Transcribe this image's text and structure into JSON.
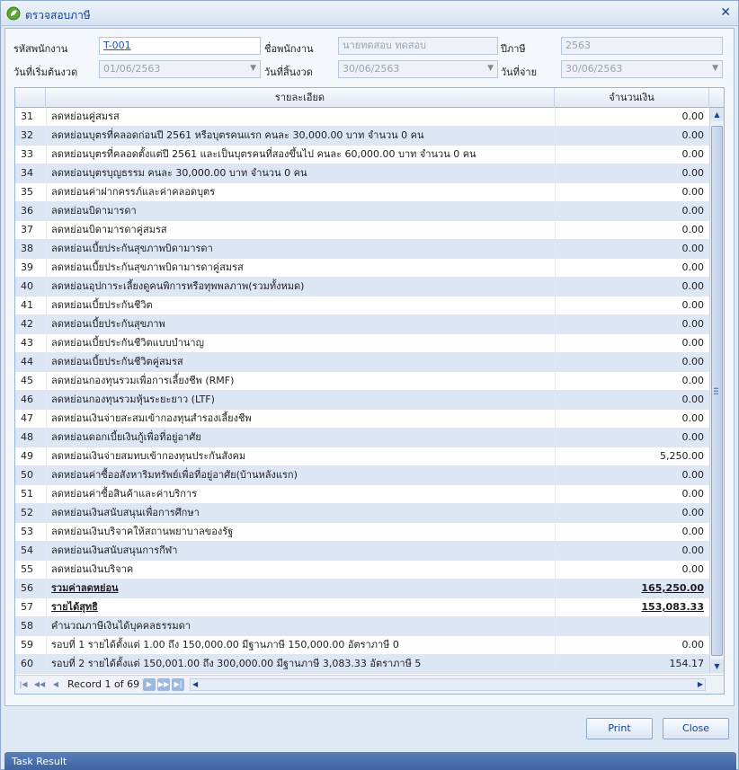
{
  "window": {
    "title": "ตรวจสอบภาษี"
  },
  "form": {
    "emp_code_label": "รหัสพนักงาน",
    "emp_code_value": "T-001",
    "emp_name_label": "ชื่อพนักงาน",
    "emp_name_value": "นายทดสอบ ทดสอบ",
    "tax_year_label": "ปีภาษี",
    "tax_year_value": "2563",
    "period_start_label": "วันที่เริ่มต้นงวด",
    "period_start_value": "01/06/2563",
    "period_end_label": "วันที่สิ้นงวด",
    "period_end_value": "30/06/2563",
    "pay_date_label": "วันที่จ่าย",
    "pay_date_value": "30/06/2563"
  },
  "grid": {
    "columns": {
      "desc": "รายละเอียด",
      "amount": "จำนวนเงิน"
    },
    "rows": [
      {
        "no": "31",
        "desc": "ลดหย่อนคู่สมรส",
        "amount": "0.00"
      },
      {
        "no": "32",
        "desc": "ลดหย่อนบุตรที่คลอดก่อนปี 2561 หรือบุตรคนแรก คนละ 30,000.00 บาท จำนวน 0 คน",
        "amount": "0.00"
      },
      {
        "no": "33",
        "desc": "ลดหย่อนบุตรที่คลอดตั้งแต่ปี 2561 และเป็นบุตรคนที่สองขึ้นไป คนละ 60,000.00 บาท จำนวน 0 คน",
        "amount": "0.00"
      },
      {
        "no": "34",
        "desc": "ลดหย่อนบุตรบุญธรรม คนละ 30,000.00 บาท จำนวน 0 คน",
        "amount": "0.00"
      },
      {
        "no": "35",
        "desc": "ลดหย่อนค่าฝากครรภ์และค่าคลอดบุตร",
        "amount": "0.00"
      },
      {
        "no": "36",
        "desc": "ลดหย่อนบิดามารดา",
        "amount": "0.00"
      },
      {
        "no": "37",
        "desc": "ลดหย่อนบิดามารดาคู่สมรส",
        "amount": "0.00"
      },
      {
        "no": "38",
        "desc": "ลดหย่อนเบี้ยประกันสุขภาพบิดามารดา",
        "amount": "0.00"
      },
      {
        "no": "39",
        "desc": "ลดหย่อนเบี้ยประกันสุขภาพบิดามารดาคู่สมรส",
        "amount": "0.00"
      },
      {
        "no": "40",
        "desc": "ลดหย่อนอุปการะเลี้ยงดูคนพิการหรือทุพพลภาพ(รวมทั้งหมด)",
        "amount": "0.00"
      },
      {
        "no": "41",
        "desc": "ลดหย่อนเบี้ยประกันชีวิต",
        "amount": "0.00"
      },
      {
        "no": "42",
        "desc": "ลดหย่อนเบี้ยประกันสุขภาพ",
        "amount": "0.00"
      },
      {
        "no": "43",
        "desc": "ลดหย่อนเบี้ยประกันชีวิตแบบบำนาญ",
        "amount": "0.00"
      },
      {
        "no": "44",
        "desc": "ลดหย่อนเบี้ยประกันชีวิตคู่สมรส",
        "amount": "0.00"
      },
      {
        "no": "45",
        "desc": "ลดหย่อนกองทุนรวมเพื่อการเลี้ยงชีพ (RMF)",
        "amount": "0.00"
      },
      {
        "no": "46",
        "desc": "ลดหย่อนกองทุนรวมหุ้นระยะยาว (LTF)",
        "amount": "0.00"
      },
      {
        "no": "47",
        "desc": "ลดหย่อนเงินจ่ายสะสมเข้ากองทุนสำรองเลี้ยงชีพ",
        "amount": "0.00"
      },
      {
        "no": "48",
        "desc": "ลดหย่อนดอกเบี้ยเงินกู้เพื่อที่อยู่อาศัย",
        "amount": "0.00"
      },
      {
        "no": "49",
        "desc": "ลดหย่อนเงินจ่ายสมทบเข้ากองทุนประกันสังคม",
        "amount": "5,250.00"
      },
      {
        "no": "50",
        "desc": "ลดหย่อนค่าซื้ออสังหาริมทรัพย์เพื่อที่อยู่อาศัย(บ้านหลังแรก)",
        "amount": "0.00"
      },
      {
        "no": "51",
        "desc": "ลดหย่อนค่าซื้อสินค้าและค่าบริการ",
        "amount": "0.00"
      },
      {
        "no": "52",
        "desc": "ลดหย่อนเงินสนับสนุนเพื่อการศึกษา",
        "amount": "0.00"
      },
      {
        "no": "53",
        "desc": "ลดหย่อนเงินบริจาคให้สถานพยาบาลของรัฐ",
        "amount": "0.00"
      },
      {
        "no": "54",
        "desc": "ลดหย่อนเงินสนับสนุนการกีฬา",
        "amount": "0.00"
      },
      {
        "no": "55",
        "desc": "ลดหย่อนเงินบริจาค",
        "amount": "0.00"
      },
      {
        "no": "56",
        "desc": "รวมค่าลดหย่อน",
        "amount": "165,250.00",
        "bold": true
      },
      {
        "no": "57",
        "desc": "รายได้สุทธิ",
        "amount": "153,083.33",
        "bold": true
      },
      {
        "no": "58",
        "desc": "คำนวณภาษีเงินได้บุคคลธรรมดา",
        "amount": ""
      },
      {
        "no": "59",
        "desc": "รอบที่  1 รายได้ตั้งแต่ 1.00 ถึง 150,000.00 มีฐานภาษี 150,000.00 อัตราภาษี  0",
        "amount": "0.00"
      },
      {
        "no": "60",
        "desc": "รอบที่  2 รายได้ตั้งแต่ 150,001.00 ถึง 300,000.00 มีฐานภาษี 3,083.33 อัตราภาษี 5",
        "amount": "154.17"
      }
    ]
  },
  "navigator": {
    "record_text": "Record 1 of 69"
  },
  "buttons": {
    "print": "Print",
    "close": "Close"
  },
  "taskbar": {
    "label": "Task Result"
  },
  "icons": {
    "app": "green-ecology-icon",
    "close": "close-icon",
    "first": "first-record-icon",
    "prev_page": "prev-page-icon",
    "prev": "prev-record-icon",
    "next": "next-record-icon",
    "next_page": "next-page-icon",
    "last": "last-record-icon"
  }
}
